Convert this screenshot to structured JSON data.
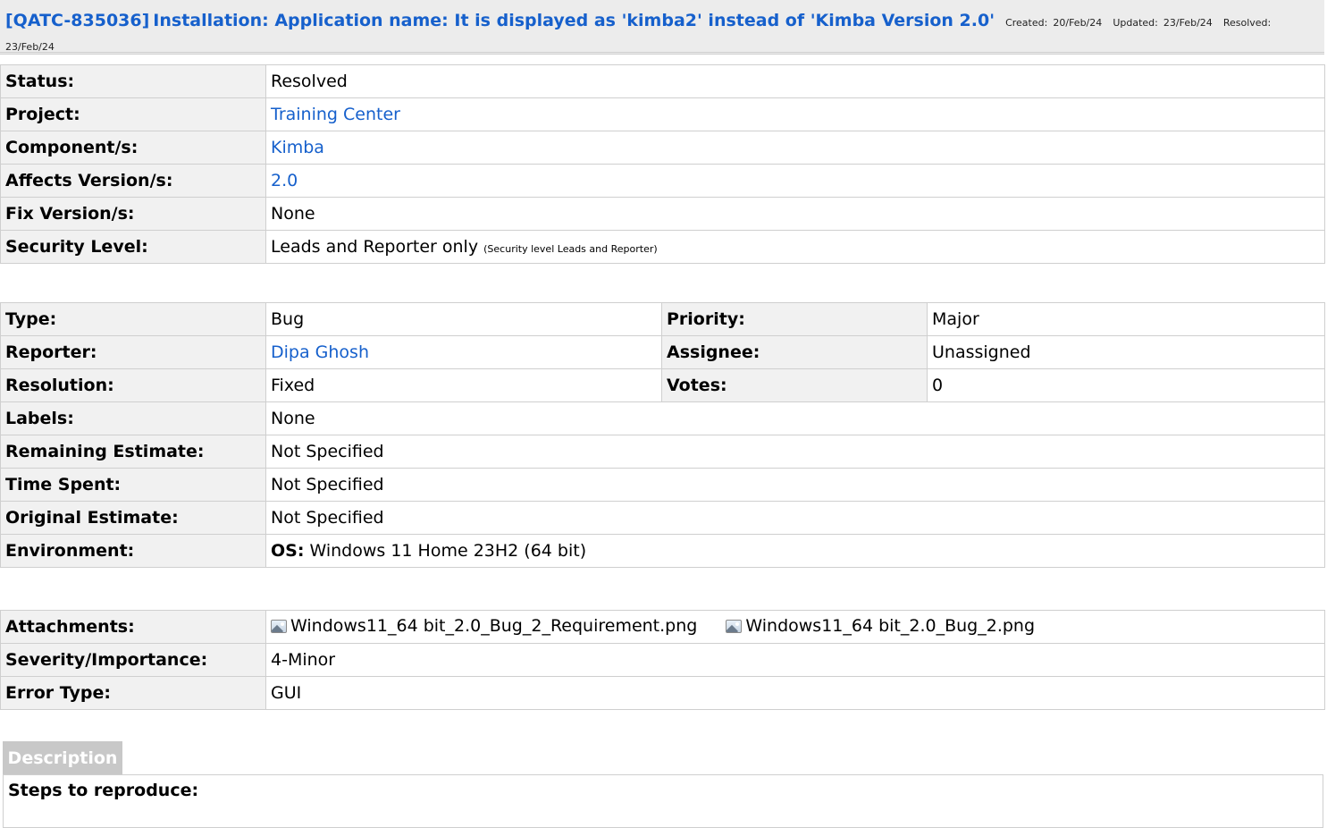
{
  "header": {
    "issue_key": "[QATC-835036]",
    "issue_title": "Installation: Application name: It is displayed as 'kimba2' instead of 'Kimba Version 2.0'",
    "created_label": "Created:",
    "created": "20/Feb/24",
    "updated_label": "Updated:",
    "updated": "23/Feb/24",
    "resolved_label": "Resolved:",
    "resolved": "23/Feb/24"
  },
  "details": {
    "status_label": "Status:",
    "status": "Resolved",
    "project_label": "Project:",
    "project": "Training Center",
    "component_label": "Component/s:",
    "component": "Kimba",
    "affects_label": "Affects Version/s:",
    "affects": "2.0",
    "fix_label": "Fix Version/s:",
    "fix": "None",
    "security_label": "Security Level:",
    "security": "Leads and Reporter only",
    "security_note": "(Security level Leads and Reporter)"
  },
  "people": {
    "type_label": "Type:",
    "type": "Bug",
    "priority_label": "Priority:",
    "priority": "Major",
    "reporter_label": "Reporter:",
    "reporter": "Dipa Ghosh",
    "assignee_label": "Assignee:",
    "assignee": "Unassigned",
    "resolution_label": "Resolution:",
    "resolution": "Fixed",
    "votes_label": "Votes:",
    "votes": "0",
    "labels_label": "Labels:",
    "labels": "None",
    "remaining_label": "Remaining Estimate:",
    "remaining": "Not Specified",
    "spent_label": "Time Spent:",
    "spent": "Not Specified",
    "original_label": "Original Estimate:",
    "original": "Not Specified",
    "environment_label": "Environment:",
    "environment_os_label": "OS:",
    "environment": "Windows 11 Home 23H2 (64 bit)"
  },
  "extra": {
    "attachments_label": "Attachments:",
    "attachments": [
      {
        "name": "Windows11_64 bit_2.0_Bug_2_Requirement.png",
        "icon": "image-file-icon"
      },
      {
        "name": "Windows11_64 bit_2.0_Bug_2.png",
        "icon": "image-file-icon"
      }
    ],
    "severity_label": "Severity/Importance:",
    "severity": "4-Minor",
    "error_type_label": "Error Type:",
    "error_type": "GUI"
  },
  "description": {
    "tab_label": "Description",
    "steps_heading": "Steps to reproduce:"
  },
  "colors": {
    "link": "#1660cc",
    "label_bg": "#f1f1f1",
    "header_bg": "#ececec",
    "border": "#cfcfcf",
    "description_tab_bg": "#c8c8c8"
  }
}
